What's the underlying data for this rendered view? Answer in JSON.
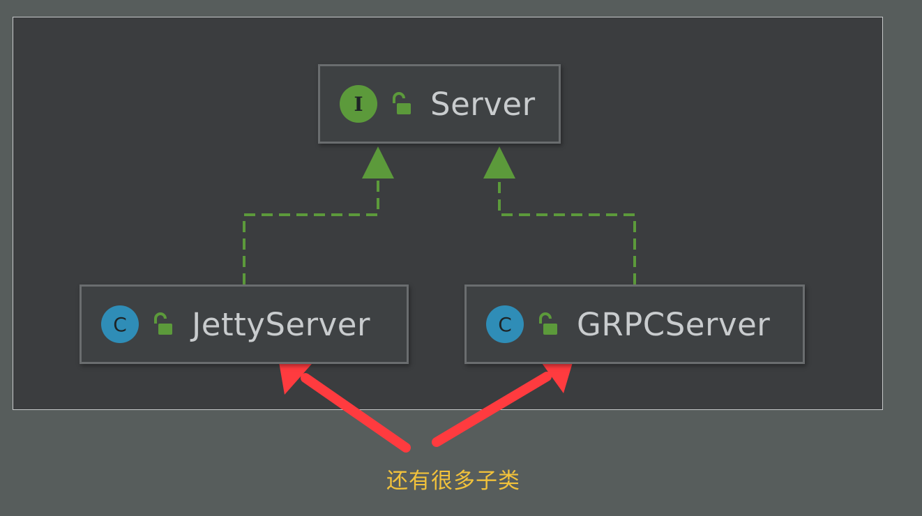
{
  "diagram": {
    "nodes": [
      {
        "id": "server",
        "kind": "interface",
        "kind_badge": "I",
        "visibility_icon": "unlocked-lock-icon",
        "label": "Server"
      },
      {
        "id": "jetty",
        "kind": "class",
        "kind_badge": "C",
        "visibility_icon": "unlocked-lock-icon",
        "label": "JettyServer"
      },
      {
        "id": "grpc",
        "kind": "class",
        "kind_badge": "C",
        "visibility_icon": "unlocked-lock-icon",
        "label": "GRPCServer"
      }
    ],
    "edges": [
      {
        "from": "jetty",
        "to": "server",
        "type": "implements",
        "style": "dashed",
        "arrowhead": "hollow-triangle"
      },
      {
        "from": "grpc",
        "to": "server",
        "type": "implements",
        "style": "dashed",
        "arrowhead": "hollow-triangle"
      }
    ],
    "colors": {
      "interface_badge": "#5c9a3b",
      "class_badge": "#2f8db7",
      "edge": "#5c9a3b",
      "node_text": "#c9ccce",
      "annotation_arrow": "#ff3b3f",
      "annotation_text": "#f2c23b"
    }
  },
  "annotation": {
    "text": "还有很多子类",
    "targets": [
      "jetty",
      "grpc"
    ]
  }
}
